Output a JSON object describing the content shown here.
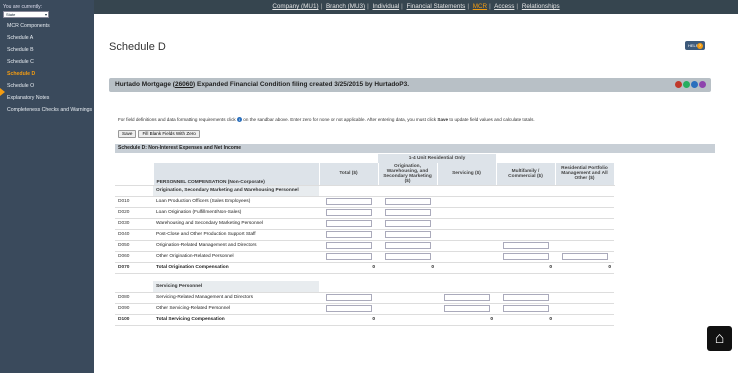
{
  "sidebar": {
    "current_label": "You are currently:",
    "state_select": "State",
    "items": [
      {
        "label": "MCR Components"
      },
      {
        "label": "Schedule A"
      },
      {
        "label": "Schedule B"
      },
      {
        "label": "Schedule C"
      },
      {
        "label": "Schedule D",
        "active": true
      },
      {
        "label": "Schedule O"
      },
      {
        "label": "Explanatory Notes"
      },
      {
        "label": "Completeness Checks and Warnings"
      }
    ]
  },
  "topnav": {
    "items": [
      "Company (MU1)",
      "Branch (MU3)",
      "Individual",
      "Financial Statements",
      "MCR",
      "Access",
      "Relationships"
    ],
    "active": "MCR"
  },
  "page": {
    "title": "Schedule D",
    "help_label": "HELP"
  },
  "banner": {
    "prefix": "Hurtado Mortgage (",
    "license_id": "26060",
    "suffix": ") Expanded Financial Condition filing created 3/25/2015 by HurtadoP3."
  },
  "instructions": {
    "part1": "For field definitions and data formatting requirements click",
    "part2": "on the sandbar above. Enter zero for none or not applicable. After entering data, you must click",
    "save_word": "Save",
    "part3": "to update field values and calculate totals."
  },
  "buttons": {
    "save": "Save",
    "fill_blank": "Fill Blank Fields With Zero"
  },
  "section_title": "Schedule D: Non-Interest Expenses and Net Income",
  "table": {
    "group_header": "1-4 Unit Residential Only",
    "first_header": "PERSONNEL COMPENSATION (Non-Corporate)",
    "columns": [
      "Total ($)",
      "Origination, Warehousing, and Secondary Marketing ($)",
      "Servicing ($)",
      "Multifamily / Commercial ($)",
      "Residential Portfolio Management and All Other ($)"
    ],
    "origination_group": "Origination, Secondary Marketing and Warehousing Personnel",
    "origination_rows": [
      {
        "code": "D010",
        "label": "Loan Production Officers (Sales Employees)"
      },
      {
        "code": "D020",
        "label": "Loan Origination (Fulfillment/Non-Sales)"
      },
      {
        "code": "D030",
        "label": "Warehousing and Secondary Marketing Personnel"
      },
      {
        "code": "D040",
        "label": "Post-Close and Other Production Support Staff"
      },
      {
        "code": "D050",
        "label": "Origination-Related Management and Directors"
      },
      {
        "code": "D060",
        "label": "Other Origination-Related Personnel"
      }
    ],
    "origination_total": {
      "code": "D070",
      "label": "Total Origination Compensation",
      "total": "0",
      "orig": "0",
      "multi": "0",
      "resid": "0"
    },
    "servicing_group": "Servicing Personnel",
    "servicing_rows": [
      {
        "code": "D080",
        "label": "Servicing-Related Management and Directors"
      },
      {
        "code": "D090",
        "label": "Other Servicing-Related Personnel"
      }
    ],
    "servicing_total": {
      "code": "D100",
      "label": "Total Servicing Compensation",
      "total": "0",
      "serv": "0",
      "multi": "0"
    }
  },
  "colors": {
    "accent": "#f39c12",
    "sidebar": "#3a4a5c",
    "nav": "#36454f"
  }
}
